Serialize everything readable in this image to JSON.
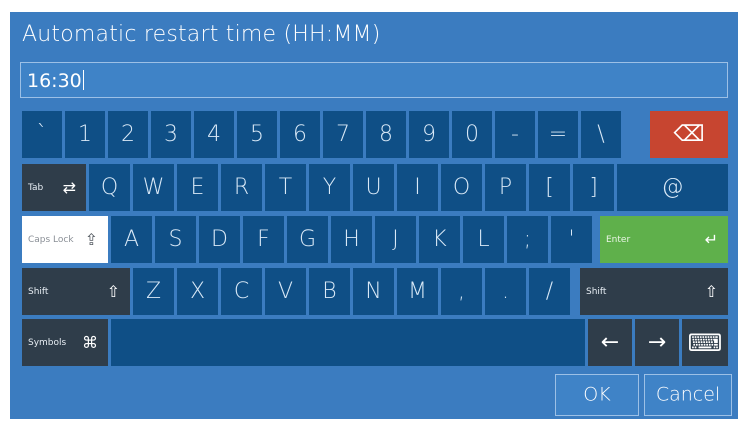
{
  "dialog": {
    "title": "Automatic restart time (HH:MM)",
    "input_value": "16:30"
  },
  "keyboard": {
    "row1": [
      "`",
      "1",
      "2",
      "3",
      "4",
      "5",
      "6",
      "7",
      "8",
      "9",
      "0",
      "-",
      "=",
      "\\"
    ],
    "backspace_icon": "⌫",
    "row2_tab_label": "Tab",
    "row2_tab_icon": "⇄",
    "row2": [
      "Q",
      "W",
      "E",
      "R",
      "T",
      "Y",
      "U",
      "I",
      "O",
      "P",
      "[",
      "]",
      "@"
    ],
    "caps_label": "Caps Lock",
    "caps_icon": "⇪",
    "row3": [
      "A",
      "S",
      "D",
      "F",
      "G",
      "H",
      "J",
      "K",
      "L",
      ";",
      "'"
    ],
    "enter_label": "Enter",
    "enter_icon": "↵",
    "shift_label": "Shift",
    "shift_icon": "⇧",
    "row4": [
      "Z",
      "X",
      "C",
      "V",
      "B",
      "N",
      "M",
      ",",
      ".",
      "/"
    ],
    "symbols_label": "Symbols",
    "symbols_icon": "⌘",
    "left_arrow": "←",
    "right_arrow": "→",
    "keyboard_icon": "⌨"
  },
  "buttons": {
    "ok": "OK",
    "cancel": "Cancel"
  },
  "colors": {
    "dialog_bg": "#3b7cc0",
    "key_bg": "#0f4f86",
    "modifier_bg": "#2f3d4a",
    "backspace_bg": "#c74530",
    "enter_bg": "#5fb04b",
    "caps_bg": "#ffffff"
  }
}
